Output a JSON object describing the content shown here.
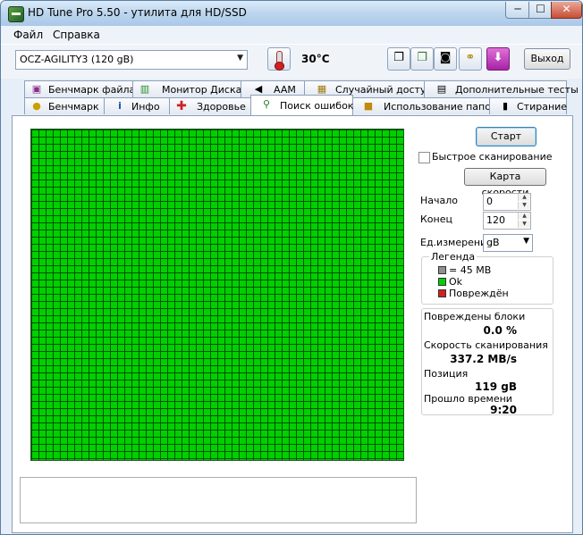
{
  "window": {
    "title": "HD Tune Pro 5.50 - утилита для HD/SSD",
    "minimize": "─",
    "maximize": "☐",
    "close": "✕"
  },
  "menu": [
    {
      "label": "Файл"
    },
    {
      "label": "Справка"
    }
  ],
  "toolbar": {
    "drive": "OCZ-AGILITY3 (120 gB)",
    "temperature": "30°C",
    "exit_label": "Выход",
    "icons": [
      "thermometer-icon",
      "copy-text-icon",
      "copy-screen-icon",
      "camera-icon",
      "link-icon",
      "save-icon"
    ]
  },
  "tabs_top": [
    {
      "label": "Бенчмарк файла",
      "icon": "file-benchmark-icon"
    },
    {
      "label": "Монитор Диска",
      "icon": "disk-monitor-icon"
    },
    {
      "label": "AAM",
      "icon": "speaker-icon"
    },
    {
      "label": "Случайный доступ",
      "icon": "random-access-icon"
    },
    {
      "label": "Дополнительные тесты",
      "icon": "extra-tests-icon"
    }
  ],
  "tabs_bottom": [
    {
      "label": "Бенчмарк",
      "icon": "bulb-icon"
    },
    {
      "label": "Инфо",
      "icon": "info-icon"
    },
    {
      "label": "Здоровье",
      "icon": "health-cross-icon"
    },
    {
      "label": "Поиск ошибок",
      "icon": "magnifier-icon",
      "active": true
    },
    {
      "label": "Использование папок",
      "icon": "folder-icon"
    },
    {
      "label": "Стирание",
      "icon": "trash-icon"
    }
  ],
  "error_scan": {
    "start_label": "Старт",
    "quick_scan_label": "Быстрое сканирование",
    "quick_scan_checked": false,
    "speed_map_label": "Карта скорости",
    "start_field_label": "Начало",
    "start_value": "0",
    "end_field_label": "Конец",
    "end_value": "120",
    "unit_label": "Ед.измерения",
    "unit_value": "gB",
    "block_status": "ok",
    "colors": {
      "ok": "#00d000",
      "damaged": "#d02020",
      "block": "#909090"
    }
  },
  "legend": {
    "title": "Легенда",
    "items": [
      {
        "label": "= 45 MB",
        "color": "#909090"
      },
      {
        "label": "Ok",
        "color": "#00d000"
      },
      {
        "label": "Повреждён",
        "color": "#d02020"
      }
    ]
  },
  "stats": {
    "damaged_label": "Повреждены блоки",
    "damaged_value": "0.0 %",
    "speed_label": "Скорость сканирования",
    "speed_value": "337.2 MB/s",
    "position_label": "Позиция",
    "position_value": "119 gB",
    "elapsed_label": "Прошло времени",
    "elapsed_value": "9:20"
  }
}
